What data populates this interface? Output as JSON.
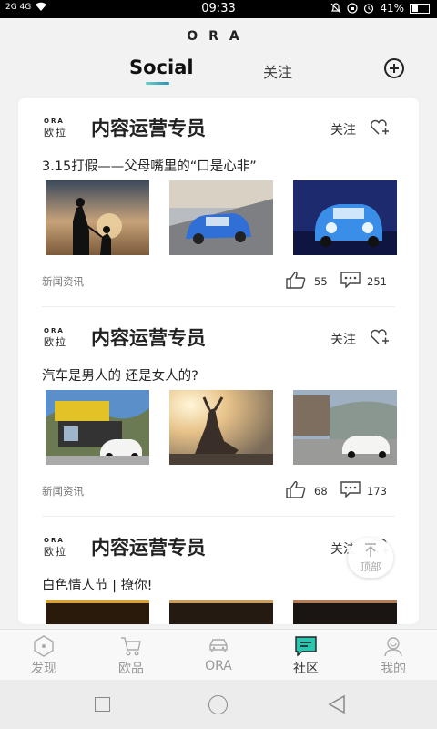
{
  "status": {
    "left_text": "2G 4G",
    "time": "09:33",
    "battery_text": "41%",
    "battery_level": 0.41
  },
  "app": {
    "logo": "ORA",
    "tab_active": "Social",
    "tab_follow": "关注"
  },
  "posts": [
    {
      "brand_top": "ORA",
      "brand_bot": "欧拉",
      "author": "内容运营专员",
      "follow": "关注",
      "title": "3.15打假——父母嘴里的“口是心非”",
      "category": "新闻资讯",
      "likes": "55",
      "comments": "251"
    },
    {
      "brand_top": "ORA",
      "brand_bot": "欧拉",
      "author": "内容运营专员",
      "follow": "关注",
      "title": "汽车是男人的 还是女人的?",
      "category": "新闻资讯",
      "likes": "68",
      "comments": "173"
    },
    {
      "brand_top": "ORA",
      "brand_bot": "欧拉",
      "author": "内容运营专员",
      "follow": "关注",
      "title": "白色情人节 | 撩你!"
    }
  ],
  "top_button": {
    "label": "顶部"
  },
  "nav": [
    {
      "label": "发现",
      "icon": "discover-icon"
    },
    {
      "label": "欧品",
      "icon": "cart-icon"
    },
    {
      "label": "ORA",
      "icon": "car-icon"
    },
    {
      "label": "社区",
      "icon": "community-icon",
      "active": true
    },
    {
      "label": "我的",
      "icon": "profile-icon"
    }
  ],
  "colors": {
    "accent_gradient_start": "#6ad3c8",
    "accent_gradient_end": "#2a8fb0",
    "car_blue": "#2f6fd6"
  }
}
